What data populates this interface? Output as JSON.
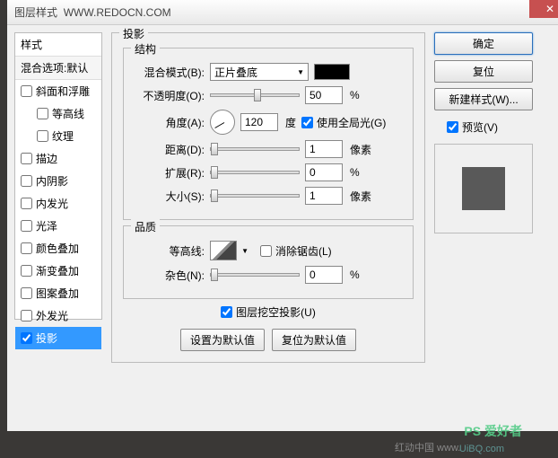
{
  "window": {
    "title": "图层样式",
    "subtitle": "WWW.REDOCN.COM",
    "close": "✕"
  },
  "sidebar": {
    "header": "样式",
    "subheader": "混合选项:默认",
    "items": [
      {
        "label": "斜面和浮雕",
        "checked": false,
        "indent": false
      },
      {
        "label": "等高线",
        "checked": false,
        "indent": true
      },
      {
        "label": "纹理",
        "checked": false,
        "indent": true
      },
      {
        "label": "描边",
        "checked": false,
        "indent": false
      },
      {
        "label": "内阴影",
        "checked": false,
        "indent": false
      },
      {
        "label": "内发光",
        "checked": false,
        "indent": false
      },
      {
        "label": "光泽",
        "checked": false,
        "indent": false
      },
      {
        "label": "颜色叠加",
        "checked": false,
        "indent": false
      },
      {
        "label": "渐变叠加",
        "checked": false,
        "indent": false
      },
      {
        "label": "图案叠加",
        "checked": false,
        "indent": false
      },
      {
        "label": "外发光",
        "checked": false,
        "indent": false
      },
      {
        "label": "投影",
        "checked": true,
        "indent": false,
        "selected": true
      }
    ]
  },
  "main": {
    "panel_title": "投影",
    "structure": {
      "title": "结构",
      "blend_mode_label": "混合模式(B):",
      "blend_mode_value": "正片叠底",
      "color": "#000000",
      "opacity_label": "不透明度(O):",
      "opacity_value": "50",
      "opacity_unit": "%",
      "angle_label": "角度(A):",
      "angle_value": "120",
      "angle_unit": "度",
      "global_light_label": "使用全局光(G)",
      "global_light_checked": true,
      "distance_label": "距离(D):",
      "distance_value": "1",
      "distance_unit": "像素",
      "spread_label": "扩展(R):",
      "spread_value": "0",
      "spread_unit": "%",
      "size_label": "大小(S):",
      "size_value": "1",
      "size_unit": "像素"
    },
    "quality": {
      "title": "品质",
      "contour_label": "等高线:",
      "antialias_label": "消除锯齿(L)",
      "antialias_checked": false,
      "noise_label": "杂色(N):",
      "noise_value": "0",
      "noise_unit": "%"
    },
    "knockout_label": "图层挖空投影(U)",
    "knockout_checked": true,
    "set_default": "设置为默认值",
    "reset_default": "复位为默认值"
  },
  "right": {
    "ok": "确定",
    "cancel": "复位",
    "new_style": "新建样式(W)...",
    "preview_label": "预览(V)",
    "preview_checked": true
  },
  "watermark": {
    "text1": "PS 爱好者",
    "text2": "UiBQ.com",
    "text3": "红动中国 www."
  }
}
